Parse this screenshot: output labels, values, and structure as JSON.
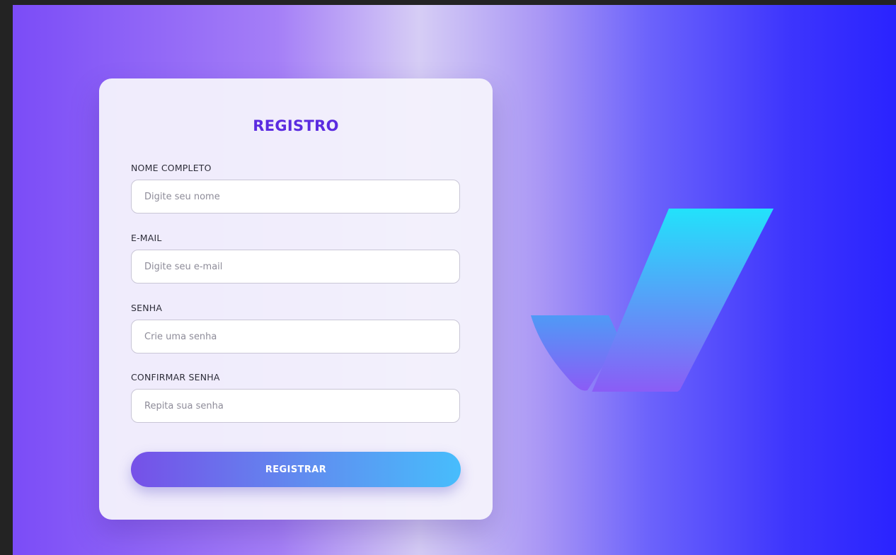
{
  "form": {
    "title": "REGISTRO",
    "fields": [
      {
        "label": "NOME COMPLETO",
        "placeholder": "Digite seu nome",
        "value": ""
      },
      {
        "label": "E-MAIL",
        "placeholder": "Digite seu e-mail",
        "value": ""
      },
      {
        "label": "SENHA",
        "placeholder": "Crie uma senha",
        "value": ""
      },
      {
        "label": "CONFIRMAR SENHA",
        "placeholder": "Repita sua senha",
        "value": ""
      }
    ],
    "submit_label": "REGISTRAR"
  },
  "logo": {
    "icon": "checkmark-logo-icon",
    "colors": {
      "top": "#22e2fb",
      "bottom": "#8b5cf6"
    }
  },
  "colors": {
    "title": "#5b2be0",
    "background_left": "#7b4cf7",
    "background_right": "#2a23ff"
  }
}
